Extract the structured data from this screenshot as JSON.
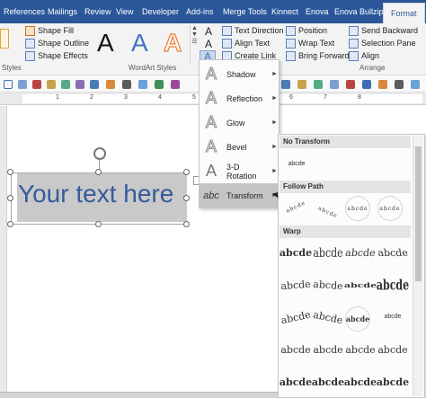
{
  "tabs": [
    "References",
    "Mailings",
    "Review",
    "View",
    "Developer",
    "Add-ins",
    "Merge Tools",
    "Kinnect",
    "Enova",
    "Enova Bullzip",
    "Format"
  ],
  "ribbon": {
    "shape_fill": "Shape Fill",
    "shape_outline": "Shape Outline",
    "shape_effects": "Shape Effects",
    "styles_label": "Styles",
    "wordart_label": "WordArt Styles",
    "wordart_sample": "A",
    "text_direction": "Text Direction",
    "align_text": "Align Text",
    "create_link": "Create Link",
    "position": "Position",
    "wrap_text": "Wrap Text",
    "bring_forward": "Bring Forward",
    "send_backward": "Send Backward",
    "selection_pane": "Selection Pane",
    "align": "Align",
    "arrange_label": "Arrange"
  },
  "ruler": {
    "n1": "1",
    "n2": "2",
    "n3": "3",
    "n4": "4",
    "n5": "5",
    "n6": "6",
    "n7": "7",
    "n8": "8"
  },
  "document": {
    "textbox_text": "Your text here"
  },
  "text_effects_menu": [
    {
      "label": "Shadow",
      "icon": "A"
    },
    {
      "label": "Reflection",
      "icon": "A"
    },
    {
      "label": "Glow",
      "icon": "A"
    },
    {
      "label": "Bevel",
      "icon": "A"
    },
    {
      "label": "3-D Rotation",
      "icon": "A"
    },
    {
      "label": "Transform",
      "icon": "abc"
    }
  ],
  "transform_gallery": {
    "no_transform": "No Transform",
    "no_transform_sample": "abcde",
    "follow_path": "Follow Path",
    "warp": "Warp",
    "sample": "abcde"
  },
  "colors": {
    "tab_bar": "#2b579a",
    "textbox_fill": "#c9c9c9",
    "textbox_text": "#355a9c",
    "highlight": "#c4c4c4"
  }
}
